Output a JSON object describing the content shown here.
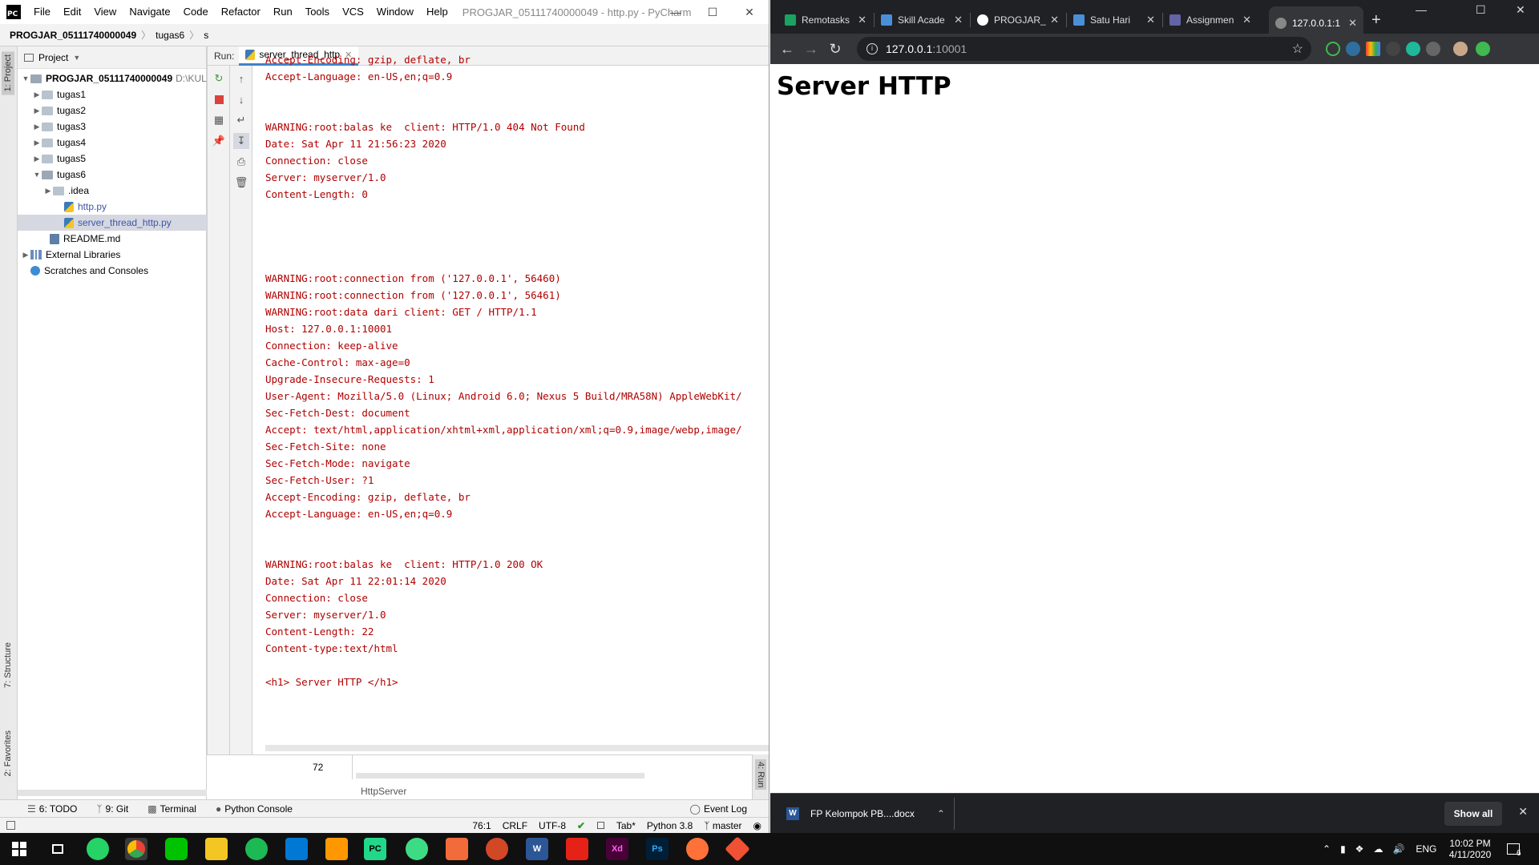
{
  "pycharm": {
    "logo": "PC",
    "menu": [
      "File",
      "Edit",
      "View",
      "Navigate",
      "Code",
      "Refactor",
      "Run",
      "Tools",
      "VCS",
      "Window",
      "Help"
    ],
    "window_title": "PROGJAR_05111740000049 - http.py - PyCharm",
    "breadcrumb": {
      "project": "PROGJAR_05111740000049",
      "folder": "tugas6",
      "truncated": "s"
    },
    "run_label": "Run:",
    "run_tab": "server_thread_http",
    "left_tabs": {
      "project": "1: Project",
      "structure": "7: Structure",
      "favorites": "2: Favorites"
    },
    "right_tab": "4: Run",
    "project_panel": {
      "title": "Project",
      "root": "PROGJAR_05111740000049",
      "root_path": "D:\\KUL",
      "folders": [
        "tugas1",
        "tugas2",
        "tugas3",
        "tugas4",
        "tugas5",
        "tugas6"
      ],
      "tugas6_children": [
        ".idea",
        "http.py",
        "server_thread_http.py"
      ],
      "readme": "README.md",
      "external": "External Libraries",
      "scratches": "Scratches and Consoles"
    },
    "console_lines": [
      "Accept-Encoding: gzip, deflate, br",
      "Accept-Language: en-US,en;q=0.9",
      "",
      "",
      "WARNING:root:balas ke  client: HTTP/1.0 404 Not Found",
      "Date: Sat Apr 11 21:56:23 2020",
      "Connection: close",
      "Server: myserver/1.0",
      "Content-Length: 0",
      "",
      "",
      "",
      "",
      "WARNING:root:connection from ('127.0.0.1', 56460)",
      "WARNING:root:connection from ('127.0.0.1', 56461)",
      "WARNING:root:data dari client: GET / HTTP/1.1",
      "Host: 127.0.0.1:10001",
      "Connection: keep-alive",
      "Cache-Control: max-age=0",
      "Upgrade-Insecure-Requests: 1",
      "User-Agent: Mozilla/5.0 (Linux; Android 6.0; Nexus 5 Build/MRA58N) AppleWebKit/",
      "Sec-Fetch-Dest: document",
      "Accept: text/html,application/xhtml+xml,application/xml;q=0.9,image/webp,image/",
      "Sec-Fetch-Site: none",
      "Sec-Fetch-Mode: navigate",
      "Sec-Fetch-User: ?1",
      "Accept-Encoding: gzip, deflate, br",
      "Accept-Language: en-US,en;q=0.9",
      "",
      "",
      "WARNING:root:balas ke  client: HTTP/1.0 200 OK",
      "Date: Sat Apr 11 22:01:14 2020",
      "Connection: close",
      "Server: myserver/1.0",
      "Content-Length: 22",
      "Content-type:text/html",
      "",
      "<h1> Server HTTP </h1>"
    ],
    "editor_line": "72",
    "editor_breadcrumb": "HttpServer",
    "bottom_tools": [
      "6: TODO",
      "9: Git",
      "Terminal",
      "Python Console"
    ],
    "event_log": "Event Log",
    "status": {
      "position": "76:1",
      "line_sep": "CRLF",
      "encoding": "UTF-8",
      "indent": "Tab*",
      "interpreter": "Python 3.8",
      "branch": "master"
    }
  },
  "chrome": {
    "tabs": [
      {
        "title": "Remotasks",
        "color": "#1aa260"
      },
      {
        "title": "Skill Acade",
        "color": "#4a90d9"
      },
      {
        "title": "PROGJAR_",
        "color": "#ffffff"
      },
      {
        "title": "Satu Hari",
        "color": "#4a90d9"
      },
      {
        "title": "Assignmen",
        "color": "#6264a7"
      },
      {
        "title": "127.0.0.1:1",
        "color": "#888888"
      }
    ],
    "url_host": "127.0.0.1",
    "url_port": ":10001",
    "page_heading": "Server HTTP",
    "download_file": "FP Kelompok PB....docx",
    "show_all": "Show all"
  },
  "taskbar": {
    "apps": [
      "WhatsApp",
      "Chrome",
      "LINE",
      "File Explorer",
      "Spotify",
      "VS Code",
      "Sublime Text",
      "PyCharm",
      "Android Studio",
      "Photoshop? Box",
      "PowerPoint",
      "Word",
      "Acrobat",
      "Adobe XD",
      "Photoshop",
      "Firefox",
      "Git"
    ],
    "language": "ENG",
    "time": "10:02 PM",
    "date": "4/11/2020",
    "notifications": "6"
  }
}
